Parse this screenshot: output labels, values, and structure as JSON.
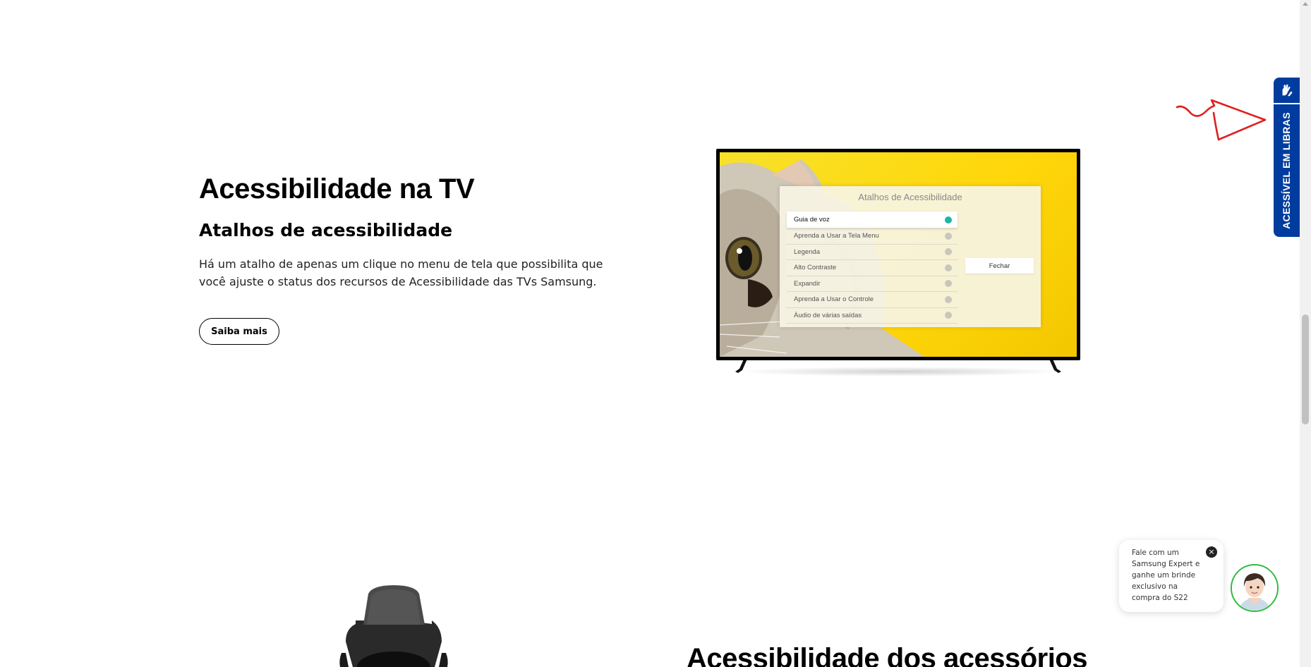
{
  "section": {
    "title": "Acessibilidade na TV",
    "subtitle": "Atalhos de acessibilidade",
    "description": "Há um atalho de apenas um clique no menu de tela que possibilita que você ajuste o status dos recursos de Acessibilidade das TVs Samsung.",
    "learn_more_label": "Saiba mais"
  },
  "tv_menu": {
    "title": "Atalhos de Acessibilidade",
    "items": [
      {
        "label": "Guia de voz",
        "active": true
      },
      {
        "label": "Aprenda a Usar a Tela Menu",
        "active": false
      },
      {
        "label": "Legenda",
        "active": false
      },
      {
        "label": "Alto Contraste",
        "active": false
      },
      {
        "label": "Expandir",
        "active": false
      },
      {
        "label": "Aprenda a Usar o Controle",
        "active": false
      },
      {
        "label": "Áudio de várias saídas",
        "active": false
      }
    ],
    "close_label": "Fechar"
  },
  "next_section": {
    "title": "Acessibilidade dos acessórios"
  },
  "chat": {
    "message": "Fale com um Samsung Expert e ganhe um brinde exclusivo na compra do S22",
    "close_symbol": "×",
    "avatar_icon": "expert-avatar-icon"
  },
  "libras": {
    "label": "ACESSÍVEL EM LIBRAS",
    "icon": "sign-language-hands-icon",
    "color": "#003c9e"
  },
  "colors": {
    "tv_background": "#ffd70a",
    "toggle_on": "#1bb6a8",
    "annotation": "#e02020",
    "chat_ring": "#2dbb3f"
  }
}
